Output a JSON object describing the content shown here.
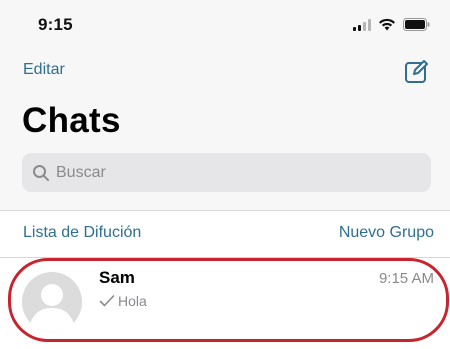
{
  "status_bar": {
    "time": "9:15",
    "icons": [
      "cellular-signal-icon",
      "wifi-icon",
      "battery-icon"
    ]
  },
  "nav": {
    "edit_label": "Editar",
    "compose_icon": "compose-icon"
  },
  "title": "Chats",
  "search": {
    "placeholder": "Buscar",
    "icon": "search-icon"
  },
  "actions": {
    "broadcast_label": "Lista de Difución",
    "new_group_label": "Nuevo Grupo"
  },
  "chats": [
    {
      "name": "Sam",
      "time": "9:15 AM",
      "last_message": "Hola",
      "status_icon": "single-check-icon"
    }
  ],
  "colors": {
    "accent": "#2f6f8f",
    "highlight": "#c8242e",
    "background": "#f7f7f7"
  }
}
